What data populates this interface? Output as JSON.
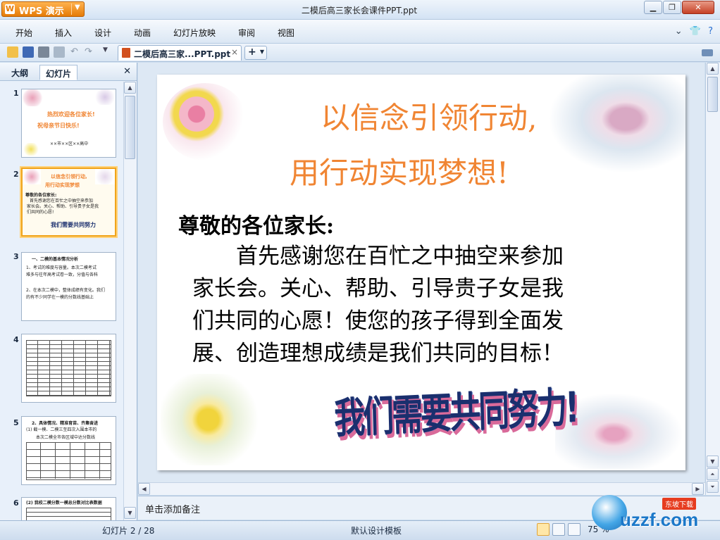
{
  "app": {
    "name": "WPS 演示",
    "document_title": "二模后高三家长会课件PPT.ppt",
    "window_buttons": [
      "minimize",
      "restore",
      "close"
    ]
  },
  "menu": {
    "items": [
      "开始",
      "插入",
      "设计",
      "动画",
      "幻灯片放映",
      "审阅",
      "视图"
    ]
  },
  "toolbar": {
    "doc_tab_label": "二模后高三家...PPT.ppt",
    "new_tab_label": "+"
  },
  "left_pane": {
    "tabs": [
      "大纲",
      "幻灯片"
    ],
    "thumbnails": [
      {
        "num": "1",
        "lines": [
          "热烈欢迎各位家长!",
          "祝母亲节日快乐!",
          "××市××区××高中"
        ]
      },
      {
        "num": "2",
        "lines": [
          "以信念引领行动,",
          "用行动实现梦想",
          "尊敬的各位家长:",
          "首先感谢您在百忙之中抽空来参加",
          "家长会。关心、帮助、引导贵子女是我",
          "们共同的心愿!",
          "我们需要共同努力"
        ]
      },
      {
        "num": "3",
        "lines": [
          "一、二模的基本情况分析",
          "1、考试的难度与容量。本次二模考试",
          "难多与往年高考试卷一致，分值与各科",
          "2、在本次二模中，整体成绩有变化。我们",
          "的有不少同学在一模的分数线基础上"
        ]
      },
      {
        "num": "4",
        "lines": []
      },
      {
        "num": "5",
        "lines": [
          "2、具体情况、精准育苗、齐集奋进",
          "(1) 截一模、二模三至四次入围本市的",
          "本次二模全市各区域中达分数线"
        ]
      },
      {
        "num": "6",
        "lines": [
          "(2) 我校二模分数一模总分数对比表数据"
        ]
      }
    ]
  },
  "slide": {
    "title_line1": "以信念引领行动,",
    "title_line2": "用行动实现梦想!",
    "greeting": "尊敬的各位家长:",
    "body_lines": [
      "首先感谢您在百忙之中抽空来参加",
      "家长会。关心、帮助、引导贵子女是我",
      "们共同的心愿！使您的孩子得到全面发",
      "展、创造理想成绩是我们共同的目标！"
    ],
    "slogan": "我们需要共同努力!"
  },
  "notes": {
    "placeholder": "单击添加备注"
  },
  "status": {
    "slide_indicator": "幻灯片 2 / 28",
    "template": "默认设计模板",
    "zoom": "75 %"
  },
  "watermark": {
    "text": "uzzf.com",
    "badge": "东坡下载"
  },
  "colors": {
    "title_orange": "#f08533",
    "slogan_navy": "#1a2f6e",
    "app_button": "#e57b07",
    "selected_thumb": "#f0a41c"
  }
}
